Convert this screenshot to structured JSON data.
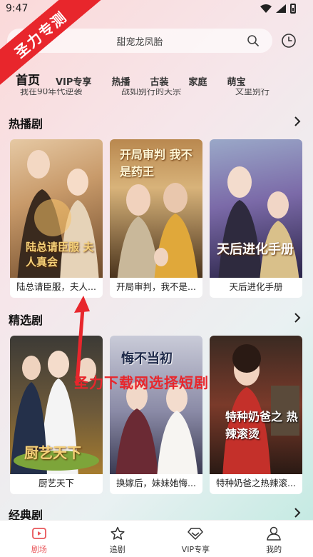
{
  "status": {
    "time": "9:47"
  },
  "ribbon": {
    "text": "圣力专测"
  },
  "search": {
    "text": "甜宠龙凤胎"
  },
  "tabs": [
    "首页",
    "VIP专享",
    "热播",
    "古装",
    "家庭",
    "萌宝"
  ],
  "prev_row": [
    "我在90年代逆袭",
    "战如别行的天宗",
    "文里别行"
  ],
  "sections": [
    {
      "title": "热播剧",
      "cards": [
        {
          "title": "陆总请臣服，夫人...",
          "poster_text": "陆总请臣服 夫人真会",
          "colors": [
            "#c89a6a",
            "#6f4a2a"
          ]
        },
        {
          "title": "开局审判，我不是...",
          "poster_text": "开局审判 我不是药王",
          "colors": [
            "#d8b37a",
            "#5a3b1c"
          ]
        },
        {
          "title": "天后进化手册",
          "poster_text": "天后进化手册",
          "colors": [
            "#7b6aa8",
            "#2a2448"
          ]
        }
      ]
    },
    {
      "title": "精选剧",
      "cards": [
        {
          "title": "厨艺天下",
          "poster_text": "厨艺天下",
          "colors": [
            "#6e5a3a",
            "#2a2a2a"
          ]
        },
        {
          "title": "换嫁后，妹妹她悔...",
          "poster_text": "悔不当初",
          "colors": [
            "#8a8aa6",
            "#3a3a52"
          ]
        },
        {
          "title": "特种奶爸之热辣滚...",
          "poster_text": "特种奶爸之 热辣滚烫",
          "colors": [
            "#7a3a2a",
            "#2a1a14"
          ]
        }
      ]
    },
    {
      "title": "经典剧"
    }
  ],
  "watermark": "圣力下载网选择短剧",
  "bottom_nav": [
    {
      "label": "剧场",
      "icon": "theater-icon",
      "active": true
    },
    {
      "label": "追剧",
      "icon": "star-icon",
      "active": false
    },
    {
      "label": "VIP专享",
      "icon": "diamond-icon",
      "active": false
    },
    {
      "label": "我的",
      "icon": "person-icon",
      "active": false
    }
  ],
  "colors": {
    "accent": "#e8565a",
    "ribbon": "#e8262c"
  }
}
